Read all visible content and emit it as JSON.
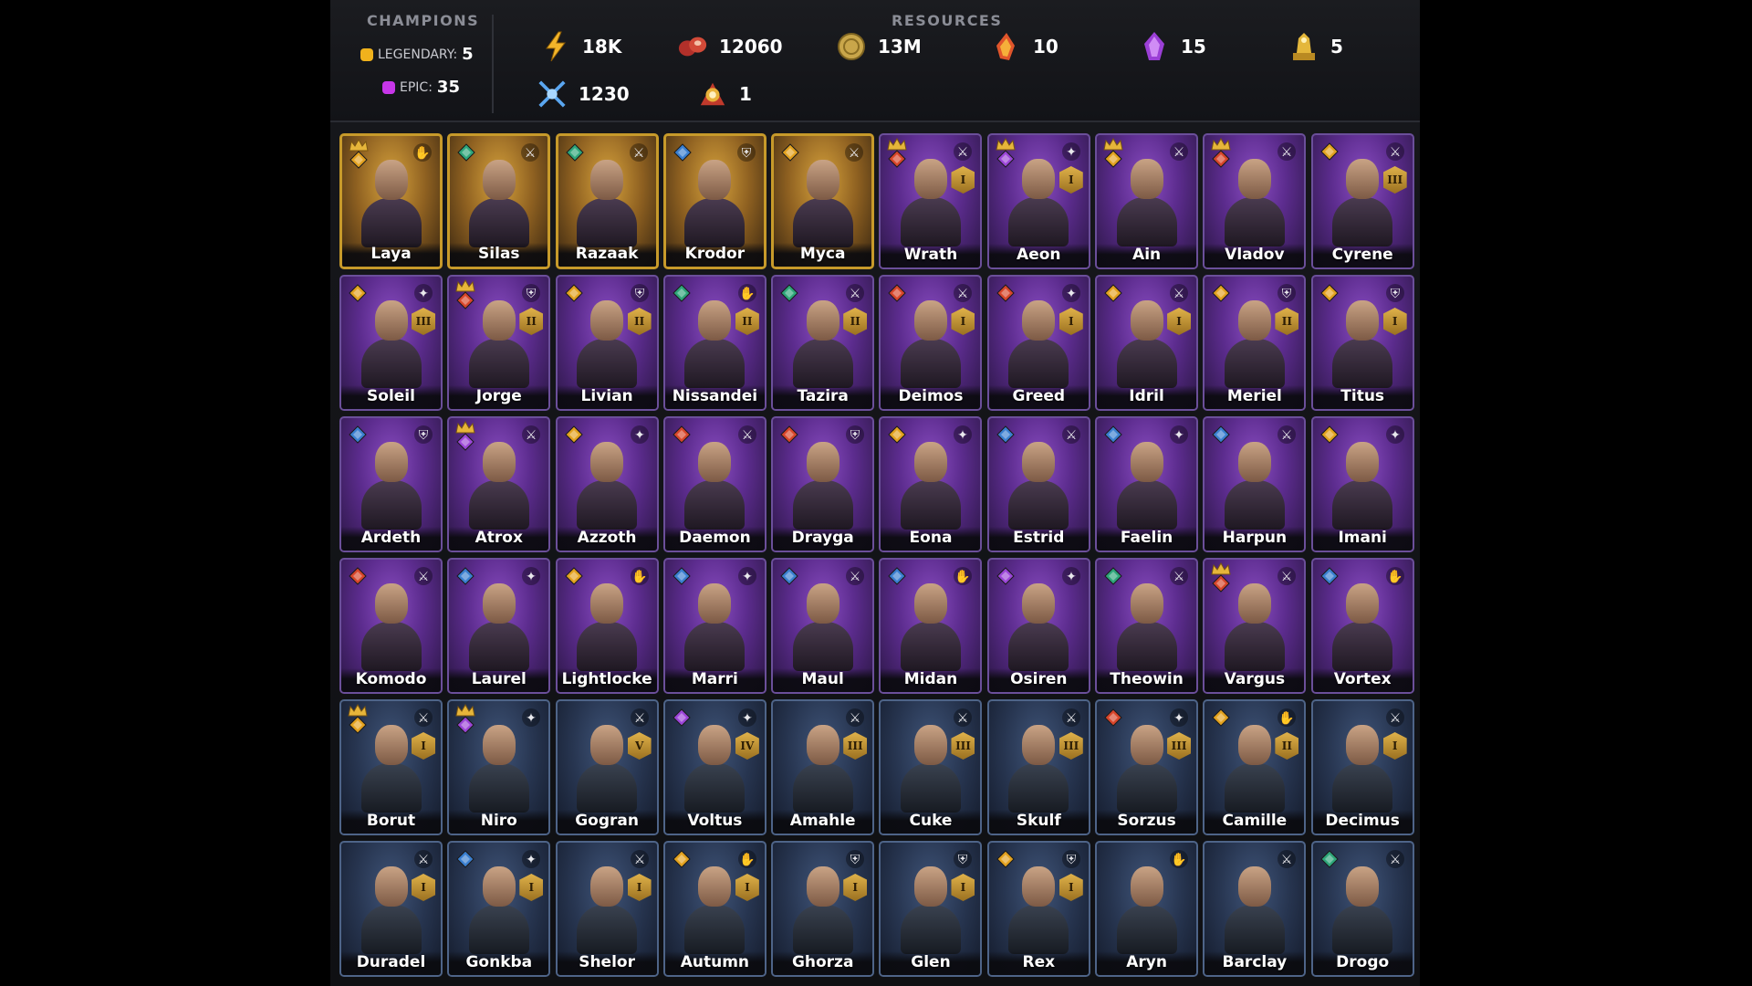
{
  "header": {
    "champions_title": "CHAMPIONS",
    "resources_title": "RESOURCES",
    "rarities": [
      {
        "label": "LEGENDARY:",
        "count": "5",
        "color": "#f0b21c"
      },
      {
        "label": "EPIC:",
        "count": "35",
        "color": "#c736e8"
      }
    ],
    "resources": [
      {
        "icon": "energy-icon",
        "value": "18K"
      },
      {
        "icon": "meat-icon",
        "value": "12060"
      },
      {
        "icon": "coin-icon",
        "value": "13M"
      },
      {
        "icon": "flame-crystal-icon",
        "value": "10"
      },
      {
        "icon": "purple-crystal-icon",
        "value": "15"
      },
      {
        "icon": "gold-statue-icon",
        "value": "5"
      },
      {
        "icon": "crossed-swords-icon",
        "value": "1230"
      },
      {
        "icon": "medal-badge-icon",
        "value": "1"
      }
    ]
  },
  "champions": [
    {
      "name": "Laya",
      "rarity": "legendary",
      "affinity": "gold",
      "role": "support",
      "crown": true,
      "rank": ""
    },
    {
      "name": "Silas",
      "rarity": "legendary",
      "affinity": "green",
      "role": "attack",
      "crown": false,
      "rank": ""
    },
    {
      "name": "Razaak",
      "rarity": "legendary",
      "affinity": "green",
      "role": "attack",
      "crown": false,
      "rank": ""
    },
    {
      "name": "Krodor",
      "rarity": "legendary",
      "affinity": "blue",
      "role": "defense",
      "crown": false,
      "rank": ""
    },
    {
      "name": "Myca",
      "rarity": "legendary",
      "affinity": "gold",
      "role": "attack",
      "crown": false,
      "rank": ""
    },
    {
      "name": "Wrath",
      "rarity": "epic",
      "affinity": "red",
      "role": "hp",
      "crown": true,
      "rank": "I"
    },
    {
      "name": "Aeon",
      "rarity": "epic",
      "affinity": "purple",
      "role": "magic",
      "crown": true,
      "rank": "I"
    },
    {
      "name": "Ain",
      "rarity": "epic",
      "affinity": "gold",
      "role": "hp",
      "crown": true,
      "rank": ""
    },
    {
      "name": "Vladov",
      "rarity": "epic",
      "affinity": "red",
      "role": "hp",
      "crown": true,
      "rank": ""
    },
    {
      "name": "Cyrene",
      "rarity": "epic",
      "affinity": "gold",
      "role": "hp",
      "crown": false,
      "rank": "III"
    },
    {
      "name": "Soleil",
      "rarity": "epic",
      "affinity": "gold",
      "role": "magic",
      "crown": false,
      "rank": "III"
    },
    {
      "name": "Jorge",
      "rarity": "epic",
      "affinity": "red",
      "role": "defense",
      "crown": true,
      "rank": "II"
    },
    {
      "name": "Livian",
      "rarity": "epic",
      "affinity": "gold",
      "role": "defense",
      "crown": false,
      "rank": "II"
    },
    {
      "name": "Nissandei",
      "rarity": "epic",
      "affinity": "green",
      "role": "support",
      "crown": false,
      "rank": "II"
    },
    {
      "name": "Tazira",
      "rarity": "epic",
      "affinity": "green",
      "role": "attack",
      "crown": false,
      "rank": "II"
    },
    {
      "name": "Deimos",
      "rarity": "epic",
      "affinity": "red",
      "role": "hp",
      "crown": false,
      "rank": "I"
    },
    {
      "name": "Greed",
      "rarity": "epic",
      "affinity": "red",
      "role": "magic",
      "crown": false,
      "rank": "I"
    },
    {
      "name": "Idril",
      "rarity": "epic",
      "affinity": "gold",
      "role": "attack",
      "crown": false,
      "rank": "I"
    },
    {
      "name": "Meriel",
      "rarity": "epic",
      "affinity": "gold",
      "role": "defense",
      "crown": false,
      "rank": "II"
    },
    {
      "name": "Titus",
      "rarity": "epic",
      "affinity": "gold",
      "role": "defense",
      "crown": false,
      "rank": "I"
    },
    {
      "name": "Ardeth",
      "rarity": "epic",
      "affinity": "blue",
      "role": "defense",
      "crown": false,
      "rank": ""
    },
    {
      "name": "Atrox",
      "rarity": "epic",
      "affinity": "purple",
      "role": "hp",
      "crown": true,
      "rank": ""
    },
    {
      "name": "Azzoth",
      "rarity": "epic",
      "affinity": "gold",
      "role": "magic",
      "crown": false,
      "rank": ""
    },
    {
      "name": "Daemon",
      "rarity": "epic",
      "affinity": "red",
      "role": "hp",
      "crown": false,
      "rank": ""
    },
    {
      "name": "Drayga",
      "rarity": "epic",
      "affinity": "red",
      "role": "defense",
      "crown": false,
      "rank": ""
    },
    {
      "name": "Eona",
      "rarity": "epic",
      "affinity": "gold",
      "role": "magic",
      "crown": false,
      "rank": ""
    },
    {
      "name": "Estrid",
      "rarity": "epic",
      "affinity": "blue",
      "role": "hp",
      "crown": false,
      "rank": ""
    },
    {
      "name": "Faelin",
      "rarity": "epic",
      "affinity": "blue",
      "role": "magic",
      "crown": false,
      "rank": ""
    },
    {
      "name": "Harpun",
      "rarity": "epic",
      "affinity": "blue",
      "role": "attack",
      "crown": false,
      "rank": ""
    },
    {
      "name": "Imani",
      "rarity": "epic",
      "affinity": "gold",
      "role": "magic",
      "crown": false,
      "rank": ""
    },
    {
      "name": "Komodo",
      "rarity": "epic",
      "affinity": "red",
      "role": "hp",
      "crown": false,
      "rank": ""
    },
    {
      "name": "Laurel",
      "rarity": "epic",
      "affinity": "blue",
      "role": "magic",
      "crown": false,
      "rank": ""
    },
    {
      "name": "Lightlocke",
      "rarity": "epic",
      "affinity": "gold",
      "role": "support",
      "crown": false,
      "rank": ""
    },
    {
      "name": "Marri",
      "rarity": "epic",
      "affinity": "blue",
      "role": "magic",
      "crown": false,
      "rank": ""
    },
    {
      "name": "Maul",
      "rarity": "epic",
      "affinity": "blue",
      "role": "attack",
      "crown": false,
      "rank": ""
    },
    {
      "name": "Midan",
      "rarity": "epic",
      "affinity": "blue",
      "role": "support",
      "crown": false,
      "rank": ""
    },
    {
      "name": "Osiren",
      "rarity": "epic",
      "affinity": "purple",
      "role": "magic",
      "crown": false,
      "rank": ""
    },
    {
      "name": "Theowin",
      "rarity": "epic",
      "affinity": "green",
      "role": "attack",
      "crown": false,
      "rank": ""
    },
    {
      "name": "Vargus",
      "rarity": "epic",
      "affinity": "red",
      "role": "attack",
      "crown": true,
      "rank": ""
    },
    {
      "name": "Vortex",
      "rarity": "epic",
      "affinity": "blue",
      "role": "support",
      "crown": false,
      "rank": ""
    },
    {
      "name": "Borut",
      "rarity": "rare",
      "affinity": "gold",
      "role": "hp",
      "crown": true,
      "rank": "I"
    },
    {
      "name": "Niro",
      "rarity": "rare",
      "affinity": "purple",
      "role": "magic",
      "crown": true,
      "rank": ""
    },
    {
      "name": "Gogran",
      "rarity": "rare",
      "affinity": "",
      "role": "hp",
      "crown": false,
      "rank": "V"
    },
    {
      "name": "Voltus",
      "rarity": "rare",
      "affinity": "purple",
      "role": "magic",
      "crown": false,
      "rank": "IV"
    },
    {
      "name": "Amahle",
      "rarity": "rare",
      "affinity": "",
      "role": "attack",
      "crown": false,
      "rank": "III"
    },
    {
      "name": "Cuke",
      "rarity": "rare",
      "affinity": "",
      "role": "attack",
      "crown": false,
      "rank": "III"
    },
    {
      "name": "Skulf",
      "rarity": "rare",
      "affinity": "",
      "role": "hp",
      "crown": false,
      "rank": "III"
    },
    {
      "name": "Sorzus",
      "rarity": "rare",
      "affinity": "red",
      "role": "magic",
      "crown": false,
      "rank": "III"
    },
    {
      "name": "Camille",
      "rarity": "rare",
      "affinity": "gold",
      "role": "support",
      "crown": false,
      "rank": "II"
    },
    {
      "name": "Decimus",
      "rarity": "rare",
      "affinity": "",
      "role": "hp",
      "crown": false,
      "rank": "I"
    },
    {
      "name": "Duradel",
      "rarity": "rare",
      "affinity": "",
      "role": "hp",
      "crown": false,
      "rank": "I"
    },
    {
      "name": "Gonkba",
      "rarity": "rare",
      "affinity": "blue",
      "role": "magic",
      "crown": false,
      "rank": "I"
    },
    {
      "name": "Shelor",
      "rarity": "rare",
      "affinity": "",
      "role": "hp",
      "crown": false,
      "rank": "I"
    },
    {
      "name": "Autumn",
      "rarity": "rare",
      "affinity": "gold",
      "role": "support",
      "crown": false,
      "rank": "I"
    },
    {
      "name": "Ghorza",
      "rarity": "rare",
      "affinity": "",
      "role": "defense",
      "crown": false,
      "rank": "I"
    },
    {
      "name": "Glen",
      "rarity": "rare",
      "affinity": "",
      "role": "defense",
      "crown": false,
      "rank": "I"
    },
    {
      "name": "Rex",
      "rarity": "rare",
      "affinity": "gold",
      "role": "defense",
      "crown": false,
      "rank": "I"
    },
    {
      "name": "Aryn",
      "rarity": "rare",
      "affinity": "",
      "role": "support",
      "crown": false,
      "rank": ""
    },
    {
      "name": "Barclay",
      "rarity": "rare",
      "affinity": "",
      "role": "hp",
      "crown": false,
      "rank": ""
    },
    {
      "name": "Drogo",
      "rarity": "rare",
      "affinity": "green",
      "role": "attack",
      "crown": false,
      "rank": ""
    }
  ],
  "colors": {
    "affinity_gold": "#e3a21f",
    "affinity_green": "#2ea67a",
    "affinity_blue": "#3a7fd0",
    "affinity_red": "#d8452a",
    "affinity_purple": "#9b45d8"
  }
}
